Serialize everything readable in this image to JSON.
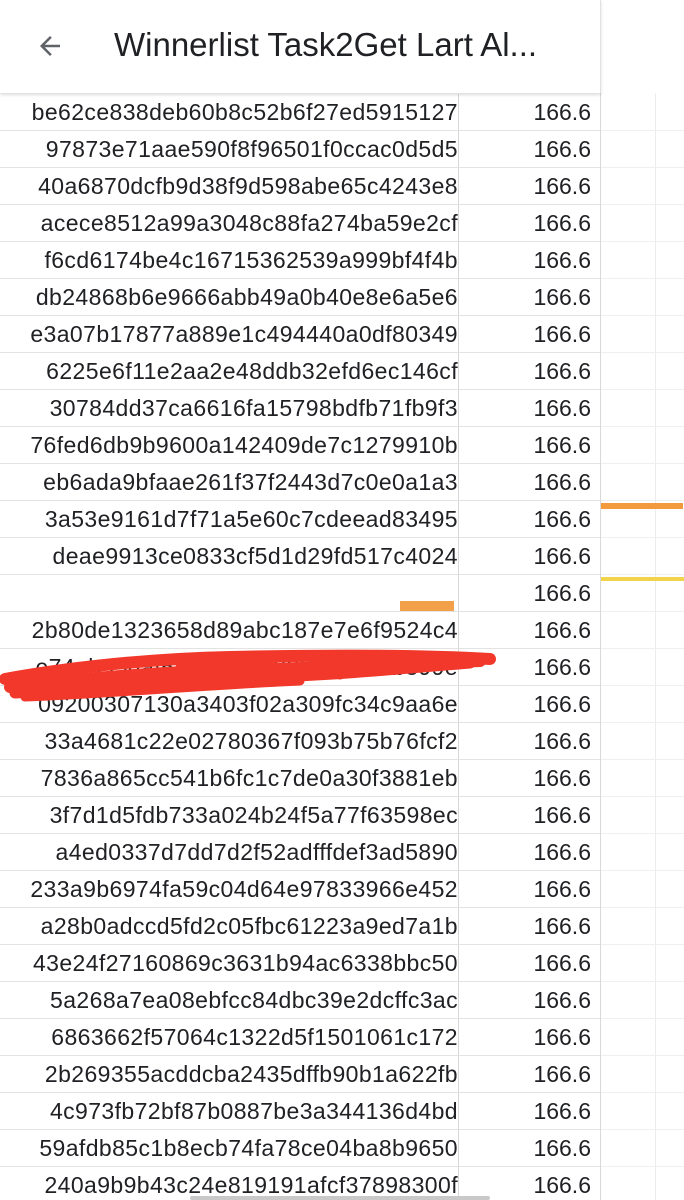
{
  "header": {
    "title": "Winnerlist Task2Get Lart Al..."
  },
  "colors": {
    "redaction_scribble": "#f2382a",
    "marker_orange": "#f49a3e",
    "marker_yellow": "#f2d44a",
    "cell_highlight": "#f2a04a"
  },
  "rows": [
    {
      "id": "be62ce838deb60b8c52b6f27ed5915127",
      "amount": "166.6"
    },
    {
      "id": "97873e71aae590f8f96501f0ccac0d5d5",
      "amount": "166.6"
    },
    {
      "id": "40a6870dcfb9d38f9d598abe65c4243e8",
      "amount": "166.6"
    },
    {
      "id": "acece8512a99a3048c88fa274ba59e2cf",
      "amount": "166.6"
    },
    {
      "id": "f6cd6174be4c16715362539a999bf4f4b",
      "amount": "166.6"
    },
    {
      "id": "db24868b6e9666abb49a0b40e8e6a5e6",
      "amount": "166.6"
    },
    {
      "id": "e3a07b17877a889e1c494440a0df80349",
      "amount": "166.6"
    },
    {
      "id": "6225e6f11e2aa2e48ddb32efd6ec146cf",
      "amount": "166.6"
    },
    {
      "id": "30784dd37ca6616fa15798bdfb71fb9f3",
      "amount": "166.6"
    },
    {
      "id": "76fed6db9b9600a142409de7c1279910b",
      "amount": "166.6"
    },
    {
      "id": "eb6ada9bfaae261f37f2443d7c0e0a1a3",
      "amount": "166.6"
    },
    {
      "id": "3a53e9161d7f71a5e60c7cdeead83495",
      "amount": "166.6"
    },
    {
      "id": "deae9913ce0833cf5d1d29fd517c4024",
      "amount": "166.6"
    },
    {
      "id": "",
      "amount": "166.6",
      "redacted": true
    },
    {
      "id": "2b80de1323658d89abc187e7e6f9524c4",
      "amount": "166.6"
    },
    {
      "id": "e74ab958af5373ae05f828345e34b899e",
      "amount": "166.6"
    },
    {
      "id": "09200307130a3403f02a309fc34c9aa6e",
      "amount": "166.6"
    },
    {
      "id": "33a4681c22e02780367f093b75b76fcf2",
      "amount": "166.6"
    },
    {
      "id": "7836a865cc541b6fc1c7de0a30f3881eb",
      "amount": "166.6"
    },
    {
      "id": "3f7d1d5fdb733a024b24f5a77f63598ec",
      "amount": "166.6"
    },
    {
      "id": "a4ed0337d7dd7d2f52adfffdef3ad5890",
      "amount": "166.6"
    },
    {
      "id": "233a9b6974fa59c04d64e97833966e452",
      "amount": "166.6"
    },
    {
      "id": "a28b0adccd5fd2c05fbc61223a9ed7a1b",
      "amount": "166.6"
    },
    {
      "id": "43e24f27160869c3631b94ac6338bbc50",
      "amount": "166.6"
    },
    {
      "id": "5a268a7ea08ebfcc84dbc39e2dcffc3ac",
      "amount": "166.6"
    },
    {
      "id": "6863662f57064c1322d5f1501061c172",
      "amount": "166.6"
    },
    {
      "id": "2b269355acddcba2435dffb90b1a622fb",
      "amount": "166.6"
    },
    {
      "id": "4c973fb72bf87b0887be3a344136d4bd",
      "amount": "166.6"
    },
    {
      "id": "59afdb85c1b8ecb74fa78ce04ba8b9650",
      "amount": "166.6"
    },
    {
      "id": "240a9b9b43c24e819191afcf37898300f",
      "amount": "166.6"
    }
  ]
}
